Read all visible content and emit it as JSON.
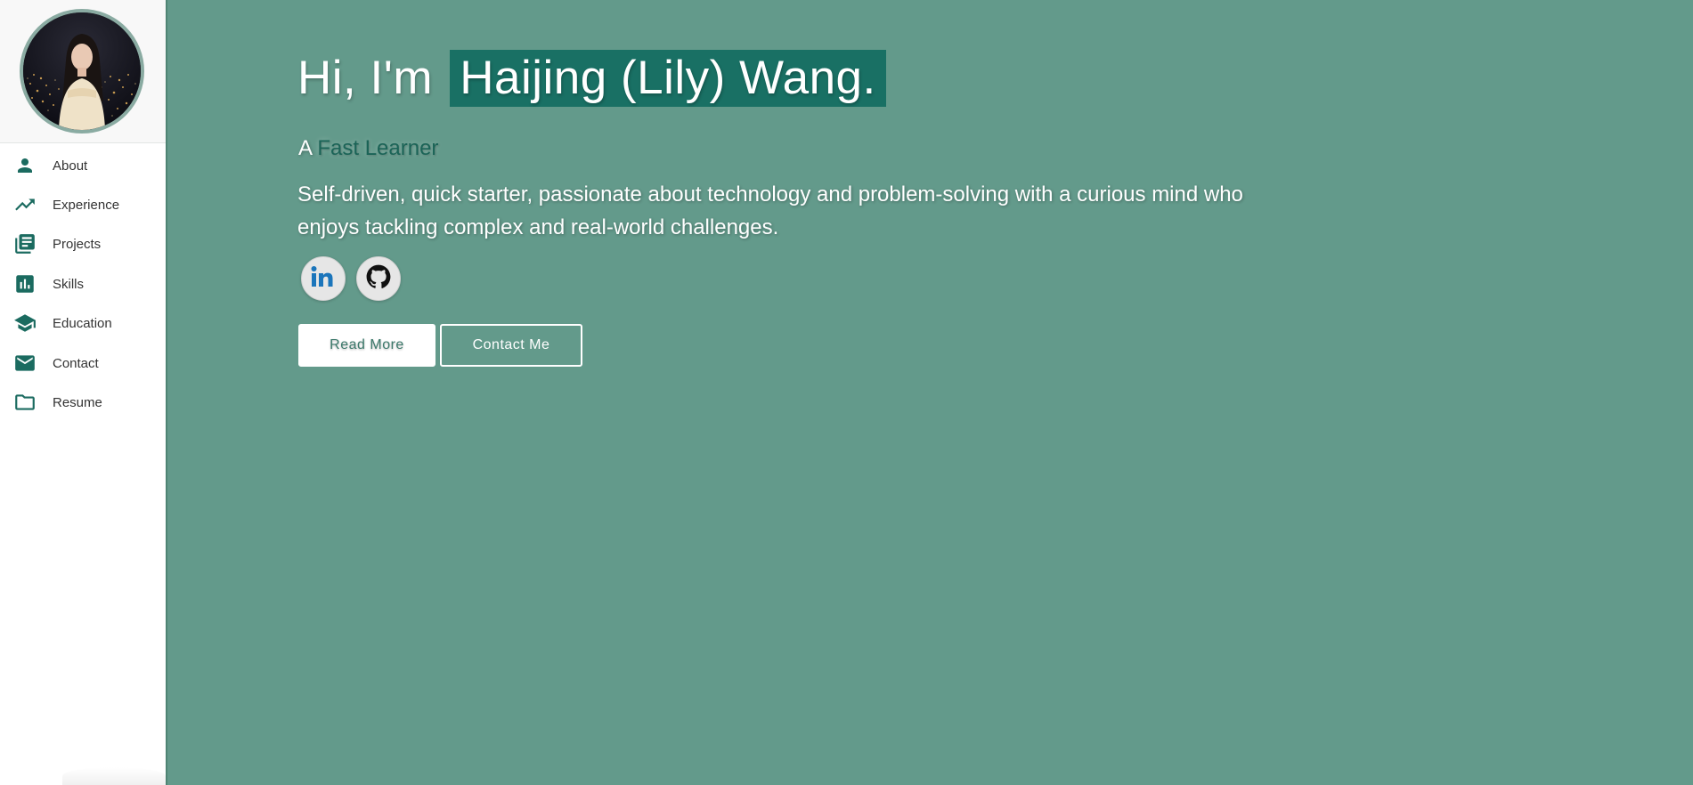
{
  "theme": {
    "accent": "#197064",
    "background": "#639a8b",
    "sidebar_bg": "#ffffff"
  },
  "sidebar": {
    "avatar_alt": "profile photo",
    "items": [
      {
        "label": "About",
        "icon": "person-icon"
      },
      {
        "label": "Experience",
        "icon": "trending-up-icon"
      },
      {
        "label": "Projects",
        "icon": "library-books-icon"
      },
      {
        "label": "Skills",
        "icon": "bar-chart-icon"
      },
      {
        "label": "Education",
        "icon": "school-icon"
      },
      {
        "label": "Contact",
        "icon": "mail-icon"
      },
      {
        "label": "Resume",
        "icon": "folder-icon"
      }
    ]
  },
  "hero": {
    "greeting": "Hi, I'm",
    "name": "Haijing (Lily) Wang.",
    "tagline_prefix": "A",
    "tagline_role": "Fast Learner",
    "bio": "Self-driven, quick starter, passionate about technology and problem-solving with a curious mind who enjoys tackling complex and real-world challenges."
  },
  "social": {
    "linkedin_icon": "linkedin-icon",
    "github_icon": "github-icon"
  },
  "buttons": {
    "read_more": "Read More",
    "contact_me": "Contact Me"
  }
}
